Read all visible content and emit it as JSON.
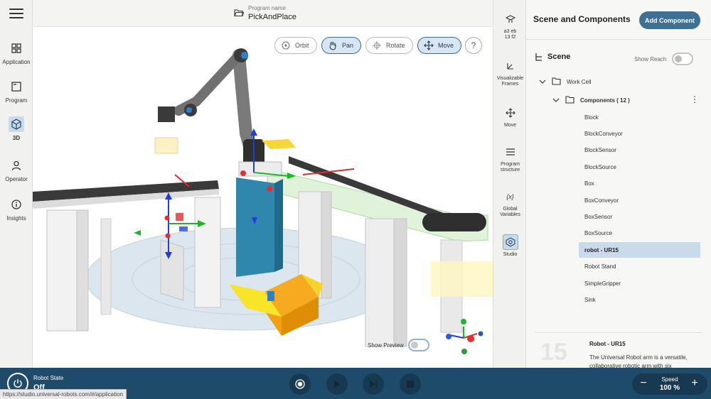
{
  "nav": {
    "items": [
      {
        "label": "Application",
        "icon": "grid-icon"
      },
      {
        "label": "Program",
        "icon": "program-icon"
      },
      {
        "label": "3D",
        "icon": "cube-icon",
        "active": true
      },
      {
        "label": "Operator",
        "icon": "person-icon"
      },
      {
        "label": "Insights",
        "icon": "info-icon"
      }
    ]
  },
  "header": {
    "program_caption": "Program name",
    "program_name": "PickAndPlace"
  },
  "viewport": {
    "tools": [
      {
        "label": "Orbit",
        "active": false
      },
      {
        "label": "Pan",
        "active": true
      },
      {
        "label": "Rotate",
        "active": false
      },
      {
        "label": "Move",
        "active": true
      }
    ],
    "help": "?",
    "show_preview": "Show Preview"
  },
  "midcol": {
    "items": [
      {
        "label": "a3 eb\n13 f2"
      },
      {
        "label": "Visualizable Frames"
      },
      {
        "label": "Move"
      },
      {
        "label": "Program structure"
      },
      {
        "label": "Global Variables"
      },
      {
        "label": "Studio",
        "active": true
      }
    ]
  },
  "panel": {
    "title": "Scene and Components",
    "add_button": "Add Component",
    "scene_label": "Scene",
    "show_reach": "Show Reach",
    "work_cell": "Work Cell",
    "components_label": "Components ( 12 )",
    "components": [
      "Block",
      "BlockConveyor",
      "BlockSensor",
      "BlockSource",
      "Box",
      "BoxConveyor",
      "BoxSensor",
      "BoxSource",
      "robot - UR15",
      "Robot Stand",
      "SimpleGripper",
      "Sink"
    ],
    "selected": "robot - UR15",
    "detail": {
      "number": "15",
      "title": "Robot - UR15",
      "desc": "The Universal Robot arm is a versatile, collaborative robotic arm with six"
    }
  },
  "bottom": {
    "robot_state_caption": "Robot State",
    "robot_state_value": "Off",
    "url": "https://studio.universal-robots.com/#/application",
    "speed_caption": "Speed",
    "speed_value": "100 %",
    "minus": "−",
    "plus": "+"
  },
  "colors": {
    "accent": "#3f6f92",
    "bottom_bar": "#1f4b6a",
    "selection": "#c9dbea",
    "box": "#f0a21f",
    "column": "#2d7fa5"
  }
}
